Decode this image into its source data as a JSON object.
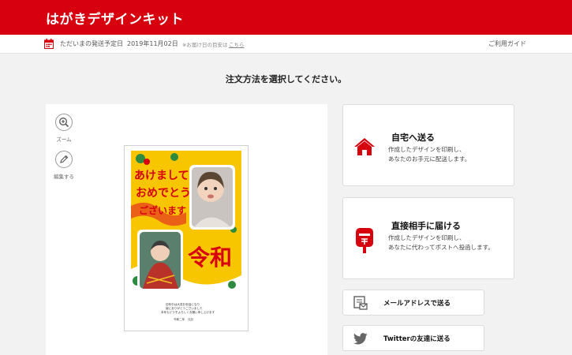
{
  "header": {
    "title": "はがきデザインキット"
  },
  "subbar": {
    "ship_label": "ただいまの発送予定日",
    "ship_date": "2019年11月02日",
    "note": "※お届け日の目安は",
    "note_link": "こちら",
    "guide": "ご利用ガイド"
  },
  "main": {
    "heading": "注文方法を選択してください。"
  },
  "preview": {
    "tools": [
      {
        "label": "ズーム",
        "icon": "zoom-in-icon"
      },
      {
        "label": "編集する",
        "icon": "pencil-icon"
      }
    ],
    "card": {
      "greeting_lines": [
        "あけまして",
        "おめでとう",
        "ございます"
      ],
      "reiwa": "令和",
      "message": [
        "旧年中は大変お世話になり",
        "誠にありがとうございました",
        "本年もどうぞよろしくお願い申し上げます"
      ],
      "sender": "令和二年　元旦"
    }
  },
  "options": {
    "home": {
      "title": "自宅へ送る",
      "desc1": "作成したデザインを印刷し、",
      "desc2": "あなたのお手元に配送します。",
      "icon": "house-icon"
    },
    "direct": {
      "title": "直接相手に届ける",
      "desc1": "作成したデザインを印刷し、",
      "desc2": "あなたに代わってポストへ投函します。",
      "icon": "postbox-icon"
    },
    "email": {
      "label": "メールアドレスで送る",
      "icon": "mail-icon"
    },
    "twitter": {
      "label": "Twitterの友達に送る",
      "icon": "twitter-icon"
    }
  },
  "colors": {
    "brand_red": "#d7000f",
    "card_yellow": "#f7c600"
  }
}
